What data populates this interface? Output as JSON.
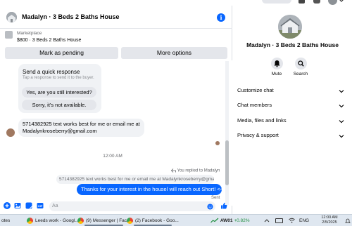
{
  "chat": {
    "title": "Madalyn · 3 Beds 2 Baths House",
    "listing": {
      "source": "Marketplace",
      "title": "$800 · 3 Beds 2 Baths House"
    },
    "actions": {
      "mark_pending": "Mark as pending",
      "more_options": "More options"
    },
    "quick_response": {
      "title": "Send a quick response",
      "subtitle": "Tap a response to send it to the buyer.",
      "options": [
        "Yes, are you still interested?",
        "Sorry, it's not available."
      ]
    },
    "incoming_message": "5714382925 text works best for me or email me at Madalynkroseberry@gmail.com",
    "time_separator": "12:00 AM",
    "replied_label": "You replied to Madalyn",
    "quoted_message": "5714382925 text works best for me or email me at Madalynkroseberry@gmail.com",
    "outgoing_message": "Thanks for your interest in the housel will reach out Short! <<",
    "sent_status": "Sent",
    "composer_placeholder": "Aa"
  },
  "side": {
    "name": "Madalyn · 3 Beds 2 Baths House",
    "buttons": {
      "mute": "Mute",
      "search": "Search"
    },
    "sections": [
      "Customize chat",
      "Chat members",
      "Media, files and links",
      "Privacy & support"
    ]
  },
  "taskbar": {
    "items": [
      {
        "label": "otes",
        "icon": "notes-icon"
      },
      {
        "label": "Leeds work - Googl...",
        "icon": "chrome-icon"
      },
      {
        "label": "(9) Messenger | Fac...",
        "icon": "chrome-icon"
      },
      {
        "label": "(2) Facebook - Goo...",
        "icon": "chrome-icon"
      }
    ],
    "stock": {
      "name": "AW01",
      "change": "+0.82%"
    },
    "language": "ENG",
    "time": "12:00 AM",
    "date": "2/5/2025"
  },
  "colors": {
    "accent": "#0866ff",
    "bubble_gray": "#f0f2f5",
    "button_gray": "#e4e6eb",
    "stock_green": "#1e8e3e"
  }
}
